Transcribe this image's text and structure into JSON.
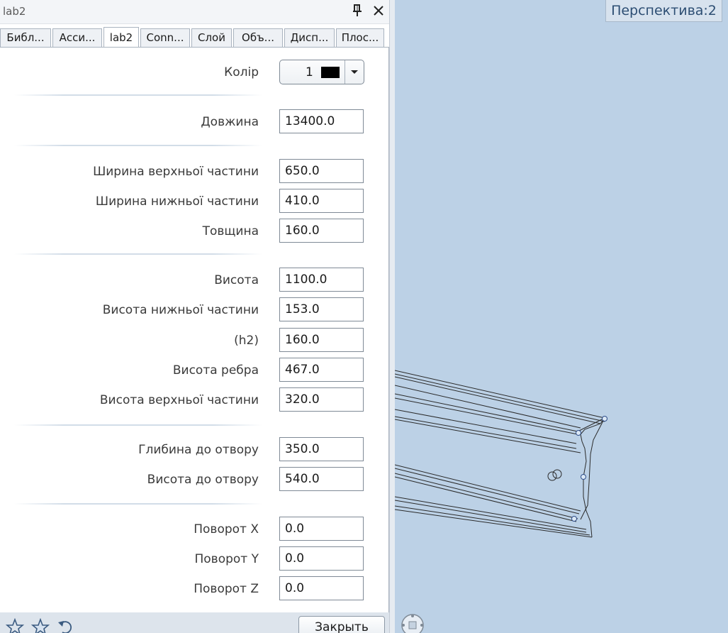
{
  "panel": {
    "title": "lab2",
    "tabs": [
      {
        "label": "Библ..."
      },
      {
        "label": "Асси..."
      },
      {
        "label": "lab2"
      },
      {
        "label": "Conn..."
      },
      {
        "label": "Слой"
      },
      {
        "label": "Объ..."
      },
      {
        "label": "Дисп..."
      },
      {
        "label": "Плос..."
      }
    ],
    "active_tab": "lab2",
    "color": {
      "label": "Колір",
      "value": "1",
      "swatch": "#000000"
    },
    "fields": {
      "length": {
        "label": "Довжина",
        "value": "13400.0"
      },
      "top_width": {
        "label": "Ширина верхньої частини",
        "value": "650.0"
      },
      "bottom_width": {
        "label": "Ширина нижньої частини",
        "value": "410.0"
      },
      "thickness": {
        "label": "Товщина",
        "value": "160.0"
      },
      "height": {
        "label": "Висота",
        "value": "1100.0"
      },
      "bottom_height": {
        "label": "Висота нижньої частини",
        "value": "153.0"
      },
      "h2": {
        "label": "(h2)",
        "value": "160.0"
      },
      "rib_height": {
        "label": "Висота ребра",
        "value": "467.0"
      },
      "top_height": {
        "label": "Висота верхньої частини",
        "value": "320.0"
      },
      "hole_depth": {
        "label": "Глибина до отвору",
        "value": "350.0"
      },
      "hole_height": {
        "label": "Висота до отвору",
        "value": "540.0"
      },
      "rot_x": {
        "label": "Поворот X",
        "value": "0.0"
      },
      "rot_y": {
        "label": "Поворот Y",
        "value": "0.0"
      },
      "rot_z": {
        "label": "Поворот Z",
        "value": "0.0"
      }
    },
    "close_button": "Закрыть"
  },
  "viewport": {
    "view_label": "Перспектива:2",
    "background": "#bcd1e6"
  },
  "colors": {
    "accent": "#2d4e73",
    "input_border": "#7f8a96"
  }
}
